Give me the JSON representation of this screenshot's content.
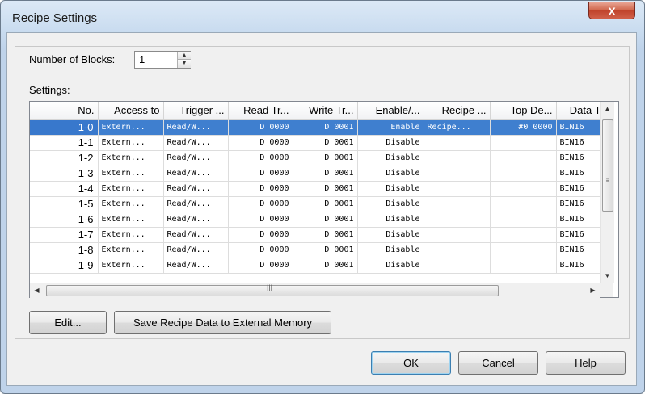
{
  "window": {
    "title": "Recipe Settings",
    "close_label": "X"
  },
  "blocks": {
    "label": "Number of Blocks:",
    "value": "1"
  },
  "settings": {
    "label": "Settings:",
    "columns": [
      "No.",
      "Access to",
      "Trigger ...",
      "Read Tr...",
      "Write Tr...",
      "Enable/...",
      "Recipe ...",
      "Top De...",
      "Data T"
    ],
    "rows": [
      [
        "1-0",
        "Extern...",
        "Read/W...",
        "D 0000",
        "D 0001",
        "Enable",
        "Recipe...",
        "#0 0000",
        "BIN16"
      ],
      [
        "1-1",
        "Extern...",
        "Read/W...",
        "D 0000",
        "D 0001",
        "Disable",
        "",
        "",
        "BIN16"
      ],
      [
        "1-2",
        "Extern...",
        "Read/W...",
        "D 0000",
        "D 0001",
        "Disable",
        "",
        "",
        "BIN16"
      ],
      [
        "1-3",
        "Extern...",
        "Read/W...",
        "D 0000",
        "D 0001",
        "Disable",
        "",
        "",
        "BIN16"
      ],
      [
        "1-4",
        "Extern...",
        "Read/W...",
        "D 0000",
        "D 0001",
        "Disable",
        "",
        "",
        "BIN16"
      ],
      [
        "1-5",
        "Extern...",
        "Read/W...",
        "D 0000",
        "D 0001",
        "Disable",
        "",
        "",
        "BIN16"
      ],
      [
        "1-6",
        "Extern...",
        "Read/W...",
        "D 0000",
        "D 0001",
        "Disable",
        "",
        "",
        "BIN16"
      ],
      [
        "1-7",
        "Extern...",
        "Read/W...",
        "D 0000",
        "D 0001",
        "Disable",
        "",
        "",
        "BIN16"
      ],
      [
        "1-8",
        "Extern...",
        "Read/W...",
        "D 0000",
        "D 0001",
        "Disable",
        "",
        "",
        "BIN16"
      ],
      [
        "1-9",
        "Extern...",
        "Read/W...",
        "D 0000",
        "D 0001",
        "Disable",
        "",
        "",
        "BIN16"
      ]
    ],
    "selected_row": 0
  },
  "buttons": {
    "edit": "Edit...",
    "save_recipe": "Save Recipe Data to External Memory",
    "ok": "OK",
    "cancel": "Cancel",
    "help": "Help"
  },
  "colors": {
    "selection": "#3f7fcf",
    "close": "#c0432b"
  }
}
